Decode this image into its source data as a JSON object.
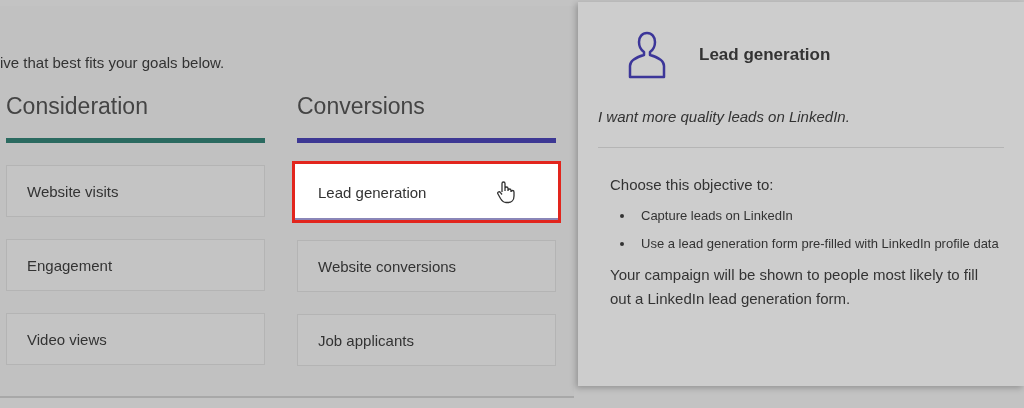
{
  "intro": "ive that best fits your goals below.",
  "columns": [
    {
      "title": "Consideration",
      "color": "#2b6a60",
      "items": [
        {
          "label": "Website visits",
          "selected": false
        },
        {
          "label": "Engagement",
          "selected": false
        },
        {
          "label": "Video views",
          "selected": false
        }
      ]
    },
    {
      "title": "Conversions",
      "color": "#3d3894",
      "items": [
        {
          "label": "Lead generation",
          "selected": true
        },
        {
          "label": "Website conversions",
          "selected": false
        },
        {
          "label": "Job applicants",
          "selected": false
        }
      ]
    }
  ],
  "popup": {
    "title": "Lead generation",
    "tagline": "I want more quality leads on LinkedIn.",
    "lead": "Choose this objective to:",
    "bullets": [
      "Capture leads on LinkedIn",
      "Use a lead generation form pre-filled with LinkedIn profile data"
    ],
    "note": "Your campaign will be shown to people most likely to fill out a LinkedIn lead generation form."
  }
}
